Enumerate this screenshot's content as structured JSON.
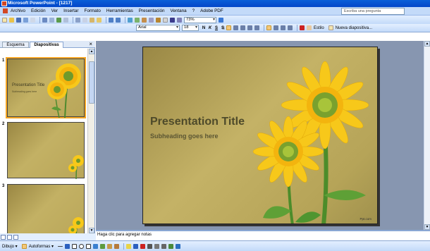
{
  "window": {
    "title": "Microsoft PowerPoint - [1217]"
  },
  "menu": {
    "items": [
      "Archivo",
      "Edición",
      "Ver",
      "Insertar",
      "Formato",
      "Herramientas",
      "Presentación",
      "Ventana",
      "?",
      "Adobe PDF"
    ],
    "help_placeholder": "Escriba una pregunta"
  },
  "standard_toolbar": {
    "zoom": "73%"
  },
  "format_toolbar": {
    "font": "Arial",
    "size": "18",
    "bold": "N",
    "italic": "K",
    "underline": "S",
    "shadow": "S",
    "design_label": "Estilo",
    "new_slide_label": "Nueva diapositiva..."
  },
  "left_pane": {
    "tabs": [
      "Esquema",
      "Diapositivas"
    ],
    "close": "×",
    "thumb_numbers": [
      "1",
      "2",
      "3"
    ],
    "thumb1_title": "Presentation Title",
    "thumb1_subtitle": "Subheading goes here"
  },
  "slide": {
    "title": "Presentation Title",
    "subtitle": "Subheading goes here",
    "credit": "Ppt.com"
  },
  "notes": {
    "placeholder": "Haga clic para agregar notas"
  },
  "drawing_toolbar": {
    "draw": "Dibujo ▾",
    "autoshapes": "Autoformas ▾"
  },
  "colors": {
    "titlebar": "#0a5fd8",
    "toolbar": "#c3daf9",
    "stage": "#8796b0",
    "slide_bg": "#c4b266",
    "petal": "#f7c81a"
  }
}
